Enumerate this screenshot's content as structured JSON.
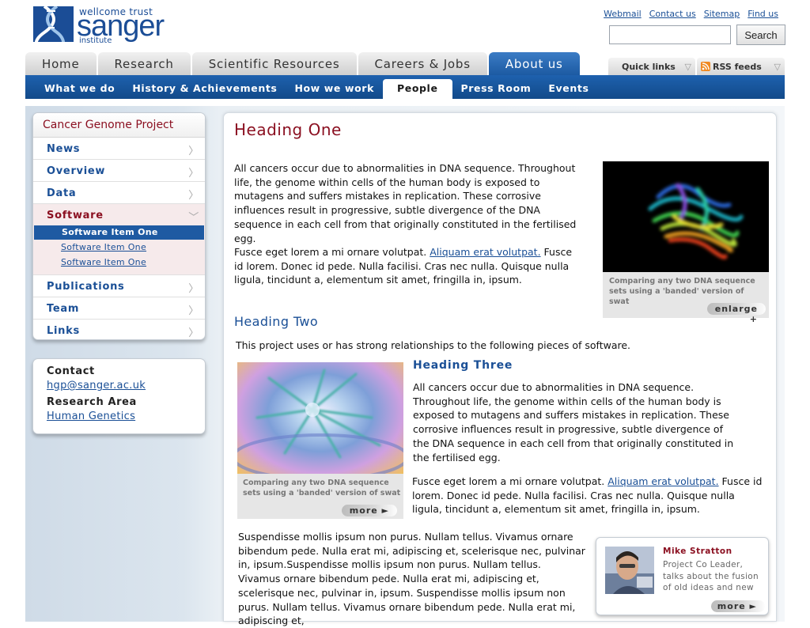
{
  "header": {
    "logo": {
      "line1": "wellcome trust",
      "wordmark": "sanger",
      "line2": "institute"
    },
    "util_links": [
      "Webmail",
      "Contact us",
      "Sitemap",
      "Find us"
    ],
    "search": {
      "value": "",
      "placeholder": "",
      "button": "Search"
    },
    "main_tabs": [
      "Home",
      "Research",
      "Scientific Resources",
      "Careers & Jobs",
      "About us"
    ],
    "main_tab_active": "About us",
    "quick_links": "Quick links",
    "rss_feeds": "RSS feeds",
    "sub_nav": [
      "What we do",
      "History & Achievements",
      "How we work",
      "People",
      "Press Room",
      "Events"
    ],
    "sub_nav_active": "People"
  },
  "sidebar": {
    "title": "Cancer Genome Project",
    "items_top": [
      "News",
      "Overview",
      "Data"
    ],
    "section": {
      "label": "Software",
      "subitems": [
        "Software Item One",
        "Software Item One",
        "Software Item One"
      ],
      "active_index": 0
    },
    "items_bottom": [
      "Publications",
      "Team",
      "Links"
    ]
  },
  "contact": {
    "contact_label": "Contact",
    "email": "hgp@sanger.ac.uk",
    "research_label": "Research Area",
    "research_value": "Human Genetics"
  },
  "main": {
    "heading_one": "Heading One",
    "para1": "All cancers occur due to abnormalities in DNA sequence. Throughout life, the genome within cells of the human body is exposed to mutagens and suffers mistakes in replication. These corrosive influences result in progressive, subtle divergence of the DNA sequence in each cell from that originally constituted in the fertilised egg.",
    "para2_before": "Fusce eget lorem a mi ornare volutpat. ",
    "para2_link": "Aliquam erat volutpat.",
    "para2_after": " Fusce id lorem. Donec id pede. Nulla facilisi. Cras nec nulla. Quisque nulla ligula, tincidunt a, elementum sit amet, fringilla in, ipsum.",
    "figure1": {
      "caption": "Comparing any two DNA sequence sets using a 'banded' version of swat",
      "button": "enlarge +"
    },
    "heading_two": "Heading Two",
    "intro": "This project uses or has strong relationships to the following pieces of software.",
    "figure2": {
      "caption": "Comparing any two DNA sequence sets using a 'banded' version of swat",
      "button": "more ►"
    },
    "heading_three": "Heading Three",
    "para3": "All cancers occur due to abnormalities in DNA sequence. Throughout life, the genome within cells of the human body is exposed to mutagens and suffers mistakes in replication. These corrosive influences result in progressive, subtle divergence of the DNA sequence in each cell from that originally constituted in the fertilised egg.",
    "para4_before": "Fusce eget lorem a mi ornare volutpat. ",
    "para4_link": "Aliquam erat volutpat.",
    "para4_after": " Fusce id lorem. Donec id pede. Nulla facilisi. Cras nec nulla. Quisque nulla ligula, tincidunt a, elementum sit amet, fringilla in, ipsum.",
    "para5": "Suspendisse mollis ipsum non purus. Nullam tellus. Vivamus ornare bibendum pede. Nulla erat mi, adipiscing et, scelerisque nec, pulvinar in, ipsum.Suspendisse mollis ipsum non purus. Nullam tellus. Vivamus ornare bibendum pede.  Nulla erat mi, adipiscing et, scelerisque nec, pulvinar in, ipsum. Suspendisse mollis ipsum non purus. Nullam tellus. Vivamus ornare bibendum pede. Nulla erat mi, adipiscing et,"
  },
  "profile": {
    "name": "Mike Stratton",
    "text": "Project Co Leader, talks about the fusion of old ideas and new",
    "button": "more ►"
  },
  "colors": {
    "brand_blue": "#1b4d96",
    "nav_blue": "#1e5aa2",
    "heading_red": "#8b1021",
    "link_blue": "#1a4f96"
  }
}
